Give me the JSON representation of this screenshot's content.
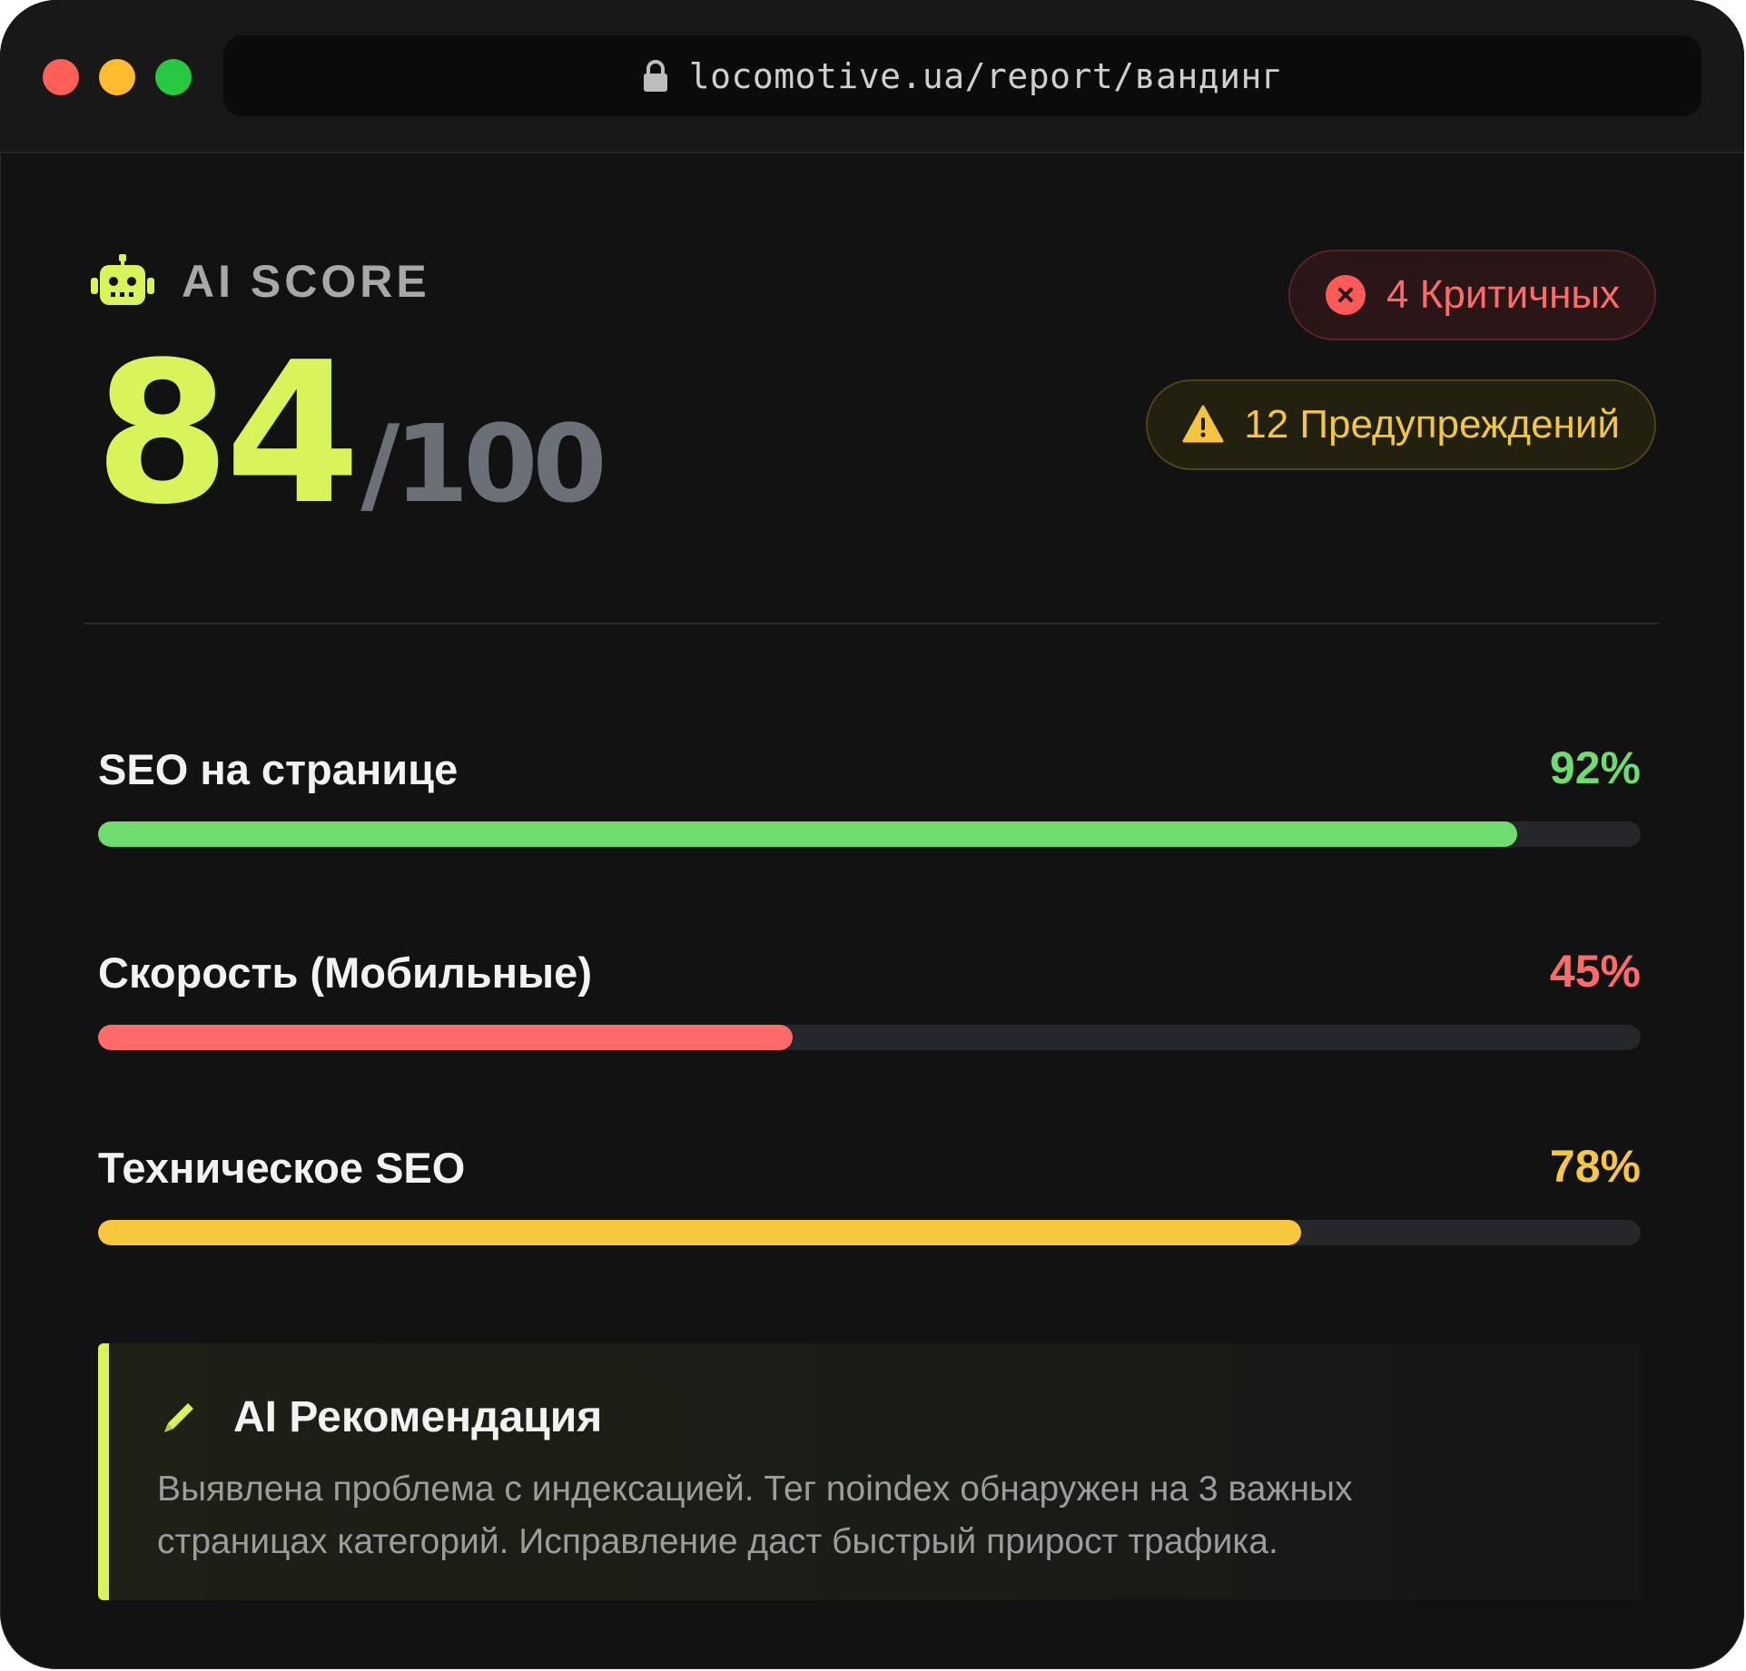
{
  "browser": {
    "url": "locomotive.ua/report/вандинг",
    "icons": [
      "close-dot",
      "minimize-dot",
      "maximize-dot",
      "lock-icon"
    ]
  },
  "score": {
    "label": "AI SCORE",
    "value": "84",
    "max": "/100",
    "icon": "robot-icon"
  },
  "badges": {
    "critical": {
      "text": "4 Критичных",
      "icon": "close-circle-icon",
      "color": "#ff6b6b"
    },
    "warnings": {
      "text": "12 Предупреждений",
      "icon": "warning-icon",
      "color": "#f4c542"
    }
  },
  "metrics": [
    {
      "label": "SEO на странице",
      "value": "92%",
      "percent": 92,
      "color": "#6fdc6f"
    },
    {
      "label": "Скорость (Мобильные)",
      "value": "45%",
      "percent": 45,
      "color": "#ff6b6b"
    },
    {
      "label": "Техническое SEO",
      "value": "78%",
      "percent": 78,
      "color": "#f7c83f"
    }
  ],
  "recommendation": {
    "title": "AI Рекомендация",
    "icon": "pencil-icon",
    "accent_color": "#d9f45a",
    "text": "Выявлена проблема с индексацией. Тег noindex обнаружен на 3 важных страницах категорий. Исправление даст быстрый прирост трафика."
  }
}
